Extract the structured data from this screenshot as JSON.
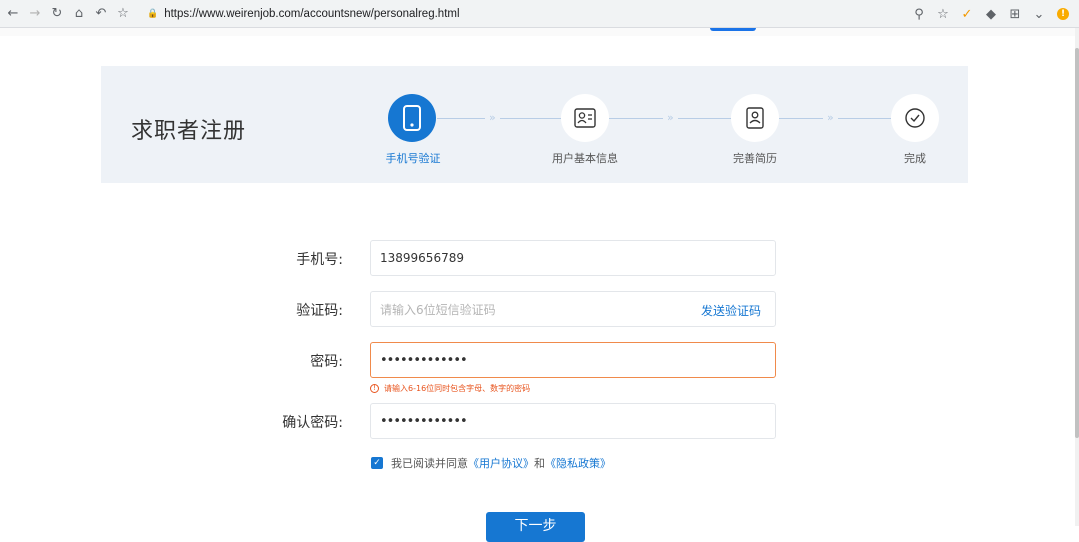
{
  "browser": {
    "url": "https://www.weirenjob.com/accountsnew/personalreg.html",
    "warning_badge": "!"
  },
  "banner": {
    "title": "求职者注册",
    "steps": [
      {
        "label": "手机号验证",
        "state": "active"
      },
      {
        "label": "用户基本信息",
        "state": "pending"
      },
      {
        "label": "完善简历",
        "state": "pending"
      },
      {
        "label": "完成",
        "state": "pending"
      }
    ],
    "arrow": "»"
  },
  "form": {
    "phone_label": "手机号:",
    "phone_value": "13899656789",
    "code_label": "验证码:",
    "code_placeholder": "请输入6位短信验证码",
    "send_code": "发送验证码",
    "password_label": "密码:",
    "password_value": "•••••••••••••",
    "password_error": "请输入6-16位同时包含字母、数字的密码",
    "confirm_label": "确认密码:",
    "confirm_value": "•••••••••••••",
    "agree_text": "我已阅读并同意",
    "agree_link1": "《用户协议》",
    "agree_and": "和",
    "agree_link2": "《隐私政策》",
    "next_button": "下一步"
  },
  "colors": {
    "accent": "#1677d2",
    "error": "#e8541e",
    "banner_bg": "#eef2f7"
  }
}
